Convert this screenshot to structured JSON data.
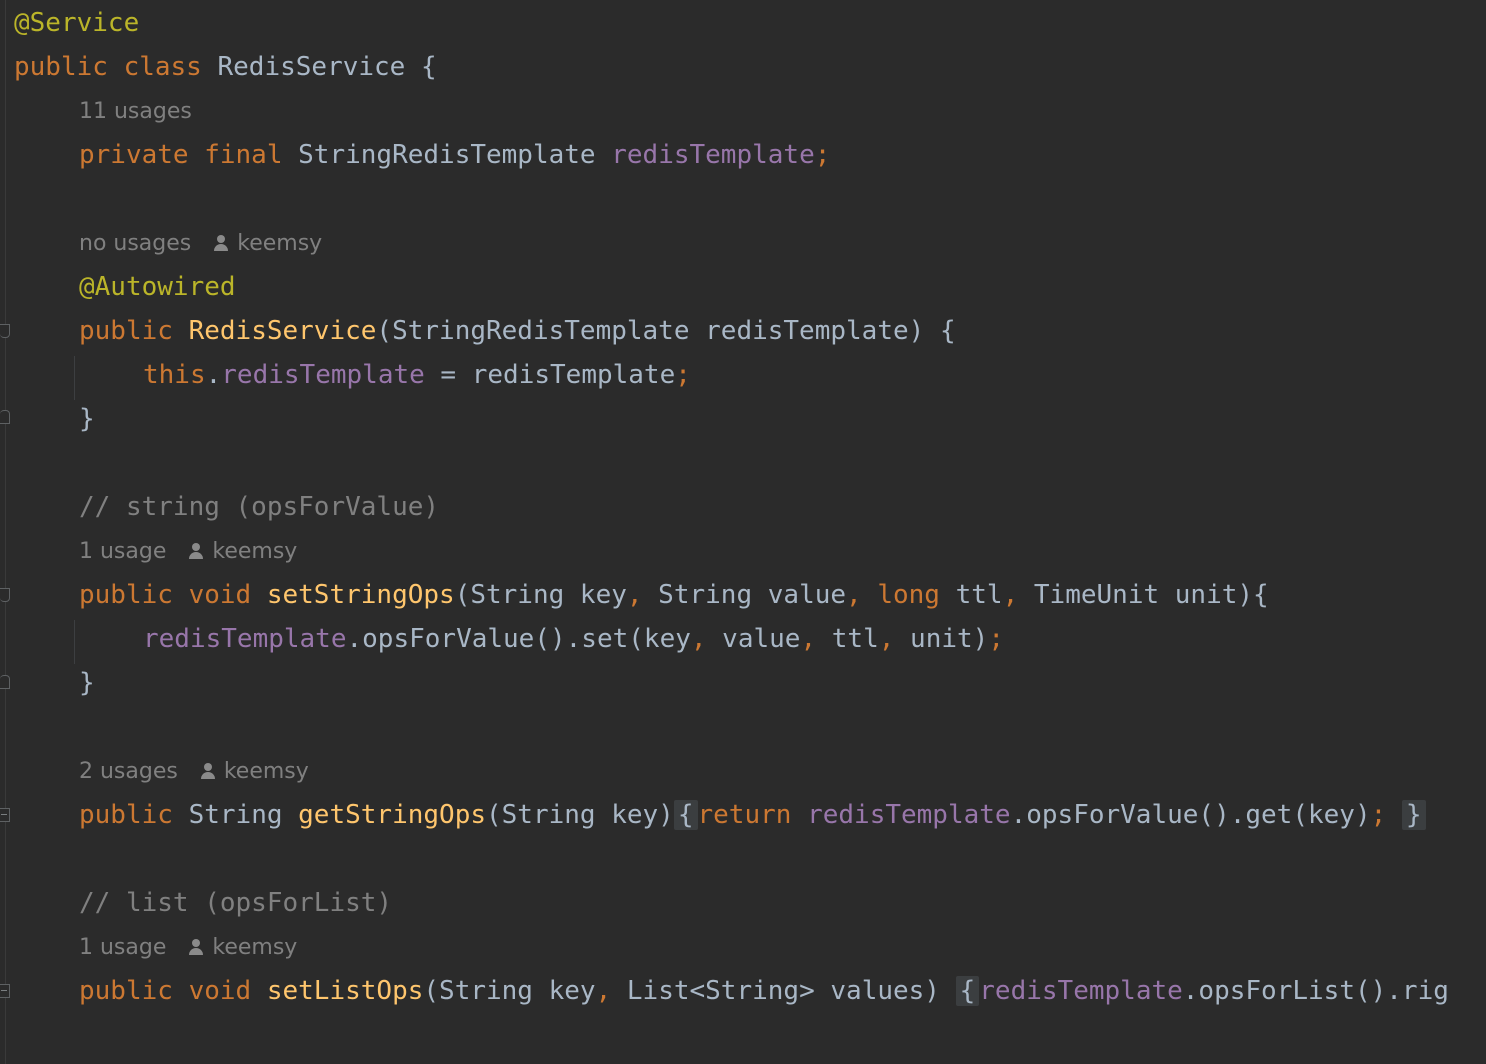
{
  "editor": {
    "lines": {
      "l1_annotation": "@Service",
      "l2_kw": "public class",
      "l2_name": "RedisService",
      "l2_brace": "{",
      "h1_usages": "11 usages",
      "l3_kw": "private final",
      "l3_type": "StringRedisTemplate",
      "l3_field": "redisTemplate",
      "l3_semi": ";",
      "h2_usages": "no usages",
      "h2_author": "keemsy",
      "l4_annotation": "@Autowired",
      "l5_kw": "public",
      "l5_name": "RedisService",
      "l5_params": "(StringRedisTemplate redisTemplate) {",
      "l6_this": "this",
      "l6_dot": ".",
      "l6_field": "redisTemplate",
      "l6_rest": " = redisTemplate",
      "l6_semi": ";",
      "l7_brace": "}",
      "l8_comment": "// string (opsForValue)",
      "h3_usages": "1 usage",
      "h3_author": "keemsy",
      "l9_kw": "public void",
      "l9_name": "setStringOps",
      "l9_p1": "(String key",
      "l9_c1": ",",
      "l9_p2": " String value",
      "l9_c2": ",",
      "l9_kw2": "long",
      "l9_p3": " ttl",
      "l9_c3": ",",
      "l9_p4": " TimeUnit unit){",
      "l10_field": "redisTemplate",
      "l10_call": ".opsForValue().set(key",
      "l10_c1": ",",
      "l10_a2": " value",
      "l10_c2": ",",
      "l10_a3": " ttl",
      "l10_c3": ",",
      "l10_a4": " unit)",
      "l10_semi": ";",
      "l11_brace": "}",
      "h4_usages": "2 usages",
      "h4_author": "keemsy",
      "l12_kw": "public",
      "l12_type": "String",
      "l12_name": "getStringOps",
      "l12_params": "(String key)",
      "l12_open": "{",
      "l12_return": "return",
      "l12_field": "redisTemplate",
      "l12_call": ".opsForValue().get(key)",
      "l12_semi": ";",
      "l12_close": "}",
      "l13_comment": "// list (opsForList)",
      "h5_usages": "1 usage",
      "h5_author": "keemsy",
      "l14_kw": "public void",
      "l14_name": "setListOps",
      "l14_p1": "(String key",
      "l14_c1": ",",
      "l14_p2": " List<String> values)",
      "l14_open": "{",
      "l14_field": "redisTemplate",
      "l14_call": ".opsForList().rig"
    },
    "icons": {
      "author": "person-icon"
    },
    "colors": {
      "background": "#2b2b2b",
      "keyword": "#cc7832",
      "annotation": "#bbb529",
      "field": "#9876aa",
      "method": "#ffc66d",
      "comment": "#808080",
      "plain": "#a9b7c6"
    }
  }
}
